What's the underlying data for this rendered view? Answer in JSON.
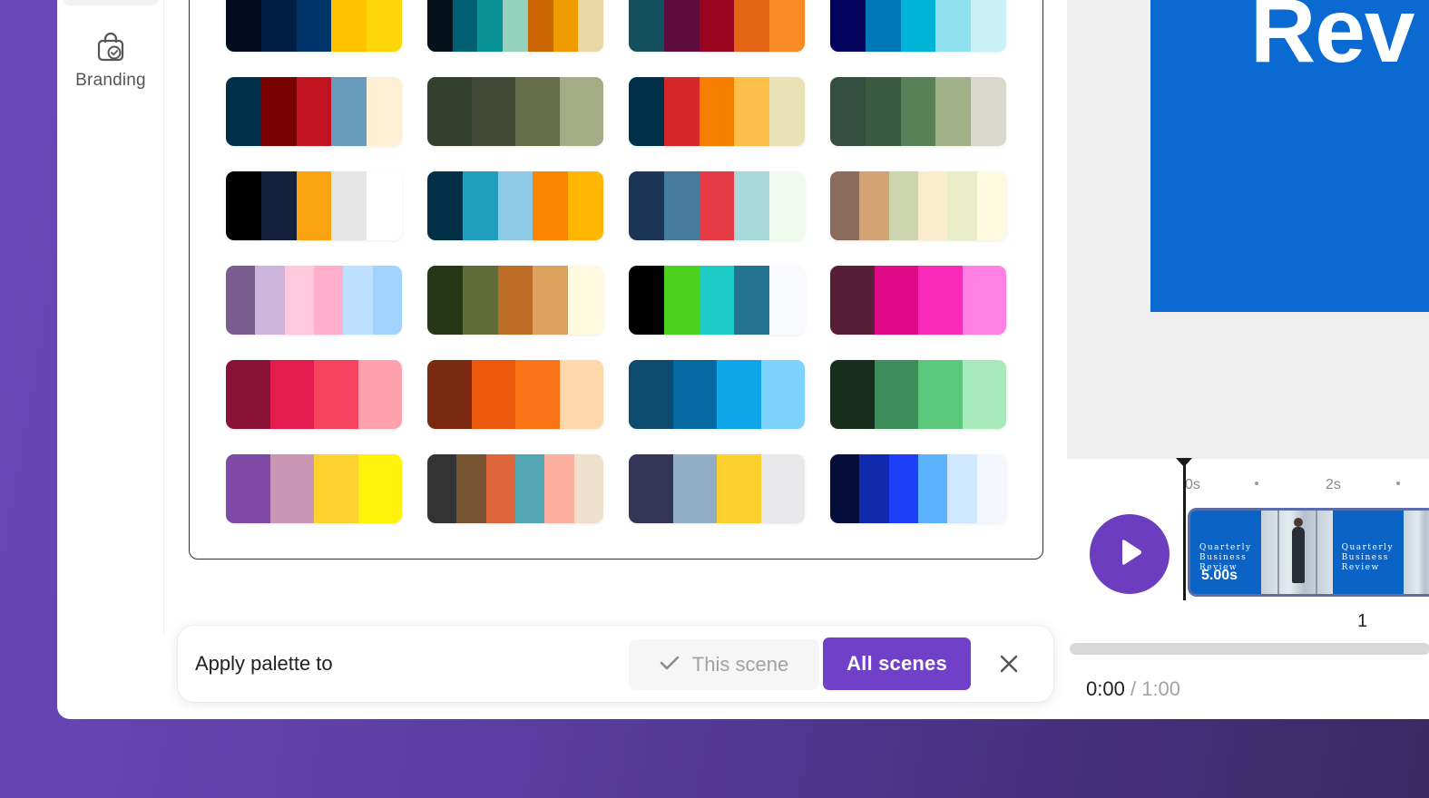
{
  "sidebar": {
    "items": [
      {
        "label": "Branding",
        "icon": "shopping-bag-icon"
      }
    ]
  },
  "palettes": [
    [
      "#030b1e",
      "#001e44",
      "#00356b",
      "#ffc300",
      "#ffd60a"
    ],
    [
      "#031219",
      "#005f73",
      "#0a9396",
      "#94d2bd",
      "#ca6702",
      "#ee9b00",
      "#e9d8a6"
    ],
    [
      "#134f5c",
      "#5e0c3d",
      "#9a031e",
      "#e36414",
      "#fb8b24"
    ],
    [
      "#03045e",
      "#0077b6",
      "#00b4d8",
      "#90e0ef",
      "#caf0f8"
    ],
    [
      "#003049",
      "#780000",
      "#c1121f",
      "#669bbc",
      "#fdf0d5"
    ],
    [
      "#343f2c",
      "#414833",
      "#656d4a",
      "#a4ac86"
    ],
    [
      "#003049",
      "#d62828",
      "#f77f00",
      "#fcbf49",
      "#eae2b7"
    ],
    [
      "#344e41",
      "#3a5a40",
      "#588157",
      "#a3b18a",
      "#dad7cd"
    ],
    [
      "#000000",
      "#14213d",
      "#fca311",
      "#e5e5e5",
      "#ffffff"
    ],
    [
      "#023047",
      "#219ebc",
      "#8ecae6",
      "#fb8500",
      "#ffb703"
    ],
    [
      "#1d3557",
      "#457b9d",
      "#e63946",
      "#a8dadc",
      "#f1faee"
    ],
    [
      "#8b6b5b",
      "#d4a373",
      "#ccd5ae",
      "#faedcd",
      "#e9edc9",
      "#fefae0"
    ],
    [
      "#7b5c8e",
      "#cdb4db",
      "#ffc8dd",
      "#ffafcc",
      "#bde0fe",
      "#a2d2ff"
    ],
    [
      "#283618",
      "#606c38",
      "#bc6c25",
      "#dda15e",
      "#fefae0"
    ],
    [
      "#000000",
      "#4cd11e",
      "#1ecbc7",
      "#247291",
      "#f8f9fc"
    ],
    [
      "#561f37",
      "#e00a88",
      "#f72bb8",
      "#ff7fe3"
    ],
    [
      "#8a1236",
      "#e31c4d",
      "#f5435f",
      "#ffa1ad"
    ],
    [
      "#7c2912",
      "#ea580c",
      "#f97316",
      "#fed7aa"
    ],
    [
      "#0c4a6e",
      "#0369a1",
      "#0ea5e9",
      "#7dd3fc"
    ],
    [
      "#172d1d",
      "#3e8e5c",
      "#5cc87c",
      "#a6e9bb"
    ],
    [
      "#7e4aa6",
      "#c997b3",
      "#fdd12e",
      "#fff20a"
    ],
    [
      "#333333",
      "#765432",
      "#e0673d",
      "#53a7b3",
      "#fdafa0",
      "#efe0cd"
    ],
    [
      "#353657",
      "#92aec6",
      "#fcd02d",
      "#e8e8ea"
    ],
    [
      "#050e3a",
      "#1029ad",
      "#1e3ff8",
      "#5db2fe",
      "#cfe8ff",
      "#f3f6fd"
    ]
  ],
  "apply_bar": {
    "label": "Apply palette to",
    "this_scene": "This scene",
    "all_scenes": "All scenes"
  },
  "preview": {
    "title_fragment": "Rev"
  },
  "timeline": {
    "ruler": [
      "0s",
      "2s"
    ],
    "scene_thumb_title": "Quarterly Business Review",
    "scene_thumb_duration": "5.00s",
    "scene_number": "1",
    "time_current": "0:00",
    "time_separator": "/",
    "time_total": "1:00"
  },
  "colors": {
    "accent": "#7040c8",
    "play_button": "#6d3dbf",
    "preview_blue": "#0a6ad2"
  }
}
